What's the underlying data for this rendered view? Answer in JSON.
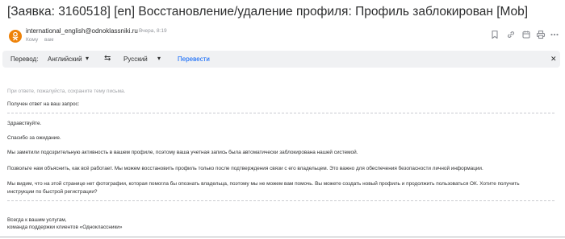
{
  "email": {
    "subject": "[Заявка: 3160518] [en] Восстановление/удаление профиля: Профиль заблокирован [Mob]",
    "sender": "international_english@odnoklassniki.ru",
    "date": "Вчера, 8:19",
    "to_label": "Кому",
    "to_value": "вам",
    "avatar_color": "#ee8208"
  },
  "toolbar": {
    "icons": [
      "bookmark-icon",
      "link-icon",
      "calendar-icon",
      "print-icon",
      "more-icon"
    ]
  },
  "translate": {
    "label": "Перевод:",
    "source_lang": "Английский",
    "target_lang": "Русский",
    "action": "Перевести",
    "link_color": "#005ff9"
  },
  "body": {
    "hint": "При ответе, пожалуйста, сохраните тему письма.",
    "received": "Получен ответ на ваш запрос:",
    "greeting": "Здравствуйте.",
    "thanks": "Спасибо за ожидание.",
    "p1": "Мы заметили подозрительную активность в вашем профиле, поэтому ваша учетная запись была автоматически заблокирована нашей системой.",
    "p2": "Позвольте нам объяснить, как всё работает. Мы можем восстановить профиль только после подтверждения связи с его владельцем. Это важно для обеспечения безопасности личной информации.",
    "p3_line1": "Мы видим, что на этой странице нет фотографии, которая помогла бы опознать владельца, поэтому мы не можем вам помочь. Вы можете создать новый профиль и продолжить пользоваться ОК. Хотите получить",
    "p3_line2": "инструкции по быстрой регистрации?",
    "sign1": "Всегда к вашим услугам,",
    "sign2": "команда поддержки клиентов «Одноклассники»"
  }
}
